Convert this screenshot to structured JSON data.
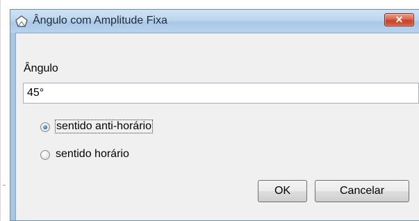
{
  "dialog": {
    "title": "Ângulo com Amplitude Fixa",
    "close_label": "✕",
    "field_label": "Ângulo",
    "angle_value": "45°",
    "options": [
      {
        "label": "sentido anti-horário",
        "selected": true
      },
      {
        "label": "sentido horário",
        "selected": false
      }
    ],
    "ok_label": "OK",
    "cancel_label": "Cancelar"
  },
  "icons": {
    "app": "angle-pentagon-icon",
    "close": "close-icon"
  },
  "colors": {
    "titlebar": "#bdd6ee",
    "close_button": "#c7432a",
    "content_bg": "#f0f0f0",
    "radio_selected": "#2a74c2"
  }
}
